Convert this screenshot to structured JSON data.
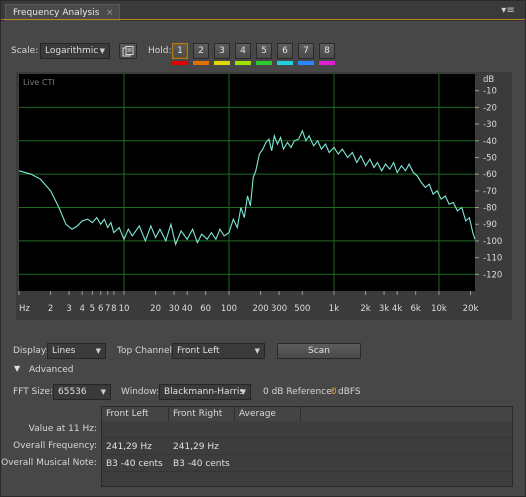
{
  "panel": {
    "tab_label": "Frequency Analysis",
    "tab_close": "×",
    "menu_glyph": "▾≡"
  },
  "controls": {
    "scale_label": "Scale:",
    "scale_value": "Logarithmic",
    "hold_label": "Hold:",
    "hold_buttons": [
      {
        "label": "1",
        "color": "#e00000"
      },
      {
        "label": "2",
        "color": "#e07000"
      },
      {
        "label": "3",
        "color": "#e0d800"
      },
      {
        "label": "4",
        "color": "#a0e000"
      },
      {
        "label": "5",
        "color": "#30c830"
      },
      {
        "label": "6",
        "color": "#20d0e0"
      },
      {
        "label": "7",
        "color": "#2888ff"
      },
      {
        "label": "8",
        "color": "#e020d0"
      }
    ]
  },
  "chart_data": {
    "type": "line",
    "overlay_label": "Live CTI",
    "ylabel": "dB",
    "x_scale": "log",
    "xlim": [
      1,
      22050
    ],
    "ylim": [
      -130,
      0
    ],
    "x_ticks": [
      {
        "v": 1,
        "label": "Hz"
      },
      {
        "v": 2,
        "label": "2"
      },
      {
        "v": 3,
        "label": "3"
      },
      {
        "v": 4,
        "label": "4"
      },
      {
        "v": 5,
        "label": "5"
      },
      {
        "v": 6,
        "label": "6"
      },
      {
        "v": 7,
        "label": "7"
      },
      {
        "v": 8,
        "label": "8"
      },
      {
        "v": 10,
        "label": "10"
      },
      {
        "v": 20,
        "label": "20"
      },
      {
        "v": 30,
        "label": "30"
      },
      {
        "v": 40,
        "label": "40"
      },
      {
        "v": 60,
        "label": "60"
      },
      {
        "v": 100,
        "label": "100"
      },
      {
        "v": 200,
        "label": "200"
      },
      {
        "v": 300,
        "label": "300"
      },
      {
        "v": 500,
        "label": "500"
      },
      {
        "v": 1000,
        "label": "1k"
      },
      {
        "v": 2000,
        "label": "2k"
      },
      {
        "v": 3000,
        "label": "3k"
      },
      {
        "v": 4000,
        "label": "4k"
      },
      {
        "v": 6000,
        "label": "6k"
      },
      {
        "v": 10000,
        "label": "10k"
      },
      {
        "v": 20000,
        "label": "20k"
      }
    ],
    "y_ticks": [
      {
        "v": -10,
        "label": "-10"
      },
      {
        "v": -20,
        "label": "-20"
      },
      {
        "v": -30,
        "label": "-30"
      },
      {
        "v": -40,
        "label": "-40"
      },
      {
        "v": -50,
        "label": "-50"
      },
      {
        "v": -60,
        "label": "-60"
      },
      {
        "v": -70,
        "label": "-70"
      },
      {
        "v": -80,
        "label": "-80"
      },
      {
        "v": -90,
        "label": "-90"
      },
      {
        "v": -100,
        "label": "-100"
      },
      {
        "v": -110,
        "label": "-110"
      },
      {
        "v": -120,
        "label": "-120"
      }
    ],
    "grid": true,
    "series": [
      {
        "color": "#7fe8d8",
        "points": [
          [
            1,
            -58
          ],
          [
            1.3,
            -60
          ],
          [
            1.6,
            -63
          ],
          [
            2,
            -70
          ],
          [
            2.4,
            -80
          ],
          [
            2.8,
            -90
          ],
          [
            3.2,
            -93
          ],
          [
            3.6,
            -91
          ],
          [
            4,
            -88
          ],
          [
            4.5,
            -87
          ],
          [
            5,
            -89
          ],
          [
            5.5,
            -86
          ],
          [
            6,
            -90
          ],
          [
            6.5,
            -87
          ],
          [
            7,
            -92
          ],
          [
            7.5,
            -89
          ],
          [
            8,
            -95
          ],
          [
            9,
            -92
          ],
          [
            10,
            -99
          ],
          [
            11,
            -93
          ],
          [
            12,
            -97
          ],
          [
            14,
            -91
          ],
          [
            16,
            -100
          ],
          [
            18,
            -91
          ],
          [
            20,
            -98
          ],
          [
            22,
            -93
          ],
          [
            25,
            -100
          ],
          [
            28,
            -90
          ],
          [
            31,
            -102
          ],
          [
            35,
            -94
          ],
          [
            40,
            -99
          ],
          [
            45,
            -93
          ],
          [
            50,
            -101
          ],
          [
            55,
            -96
          ],
          [
            62,
            -99
          ],
          [
            68,
            -95
          ],
          [
            75,
            -99
          ],
          [
            82,
            -93
          ],
          [
            90,
            -97
          ],
          [
            100,
            -95
          ],
          [
            110,
            -87
          ],
          [
            120,
            -92
          ],
          [
            130,
            -80
          ],
          [
            140,
            -86
          ],
          [
            150,
            -73
          ],
          [
            160,
            -79
          ],
          [
            170,
            -62
          ],
          [
            180,
            -58
          ],
          [
            195,
            -48
          ],
          [
            210,
            -45
          ],
          [
            225,
            -41
          ],
          [
            240,
            -39
          ],
          [
            255,
            -46
          ],
          [
            270,
            -37
          ],
          [
            290,
            -42
          ],
          [
            310,
            -38
          ],
          [
            330,
            -45
          ],
          [
            360,
            -41
          ],
          [
            390,
            -44
          ],
          [
            420,
            -40
          ],
          [
            460,
            -39
          ],
          [
            500,
            -34
          ],
          [
            540,
            -40
          ],
          [
            580,
            -37
          ],
          [
            640,
            -43
          ],
          [
            700,
            -40
          ],
          [
            760,
            -45
          ],
          [
            830,
            -42
          ],
          [
            900,
            -47
          ],
          [
            1000,
            -44
          ],
          [
            1100,
            -48
          ],
          [
            1200,
            -45
          ],
          [
            1350,
            -50
          ],
          [
            1500,
            -47
          ],
          [
            1650,
            -53
          ],
          [
            1800,
            -49
          ],
          [
            2000,
            -55
          ],
          [
            2200,
            -51
          ],
          [
            2400,
            -56
          ],
          [
            2600,
            -53
          ],
          [
            2850,
            -58
          ],
          [
            3100,
            -54
          ],
          [
            3400,
            -57
          ],
          [
            3700,
            -53
          ],
          [
            4000,
            -59
          ],
          [
            4400,
            -55
          ],
          [
            4800,
            -58
          ],
          [
            5200,
            -54
          ],
          [
            5700,
            -59
          ],
          [
            6200,
            -61
          ],
          [
            6800,
            -65
          ],
          [
            7400,
            -68
          ],
          [
            8100,
            -66
          ],
          [
            8800,
            -72
          ],
          [
            9600,
            -70
          ],
          [
            10500,
            -75
          ],
          [
            11500,
            -73
          ],
          [
            12500,
            -78
          ],
          [
            13700,
            -77
          ],
          [
            15000,
            -82
          ],
          [
            16500,
            -80
          ],
          [
            18000,
            -88
          ],
          [
            19500,
            -86
          ],
          [
            21000,
            -95
          ],
          [
            22050,
            -99
          ]
        ]
      }
    ]
  },
  "display": {
    "display_label": "Display:",
    "display_value": "Lines",
    "top_channel_label": "Top Channel:",
    "top_channel_value": "Front Left",
    "scan_label": "Scan"
  },
  "advanced": {
    "label": "Advanced",
    "fft_label": "FFT Size:",
    "fft_value": "65536",
    "window_label": "Window:",
    "window_value": "Blackmann-Harris",
    "zero_ref_label": "0 dB Reference:",
    "zero_ref_value": "0",
    "zero_ref_unit": "dBFS"
  },
  "table": {
    "columns": [
      "Front Left",
      "Front Right",
      "Average"
    ],
    "rows": [
      {
        "label": "Value at 11 Hz:",
        "values": [
          "",
          "",
          ""
        ]
      },
      {
        "label": "Overall Frequency:",
        "values": [
          "241,29 Hz",
          "241,29 Hz",
          ""
        ]
      },
      {
        "label": "Overall Musical Note:",
        "values": [
          "B3 -40 cents",
          "B3 -40 cents",
          ""
        ]
      }
    ]
  }
}
